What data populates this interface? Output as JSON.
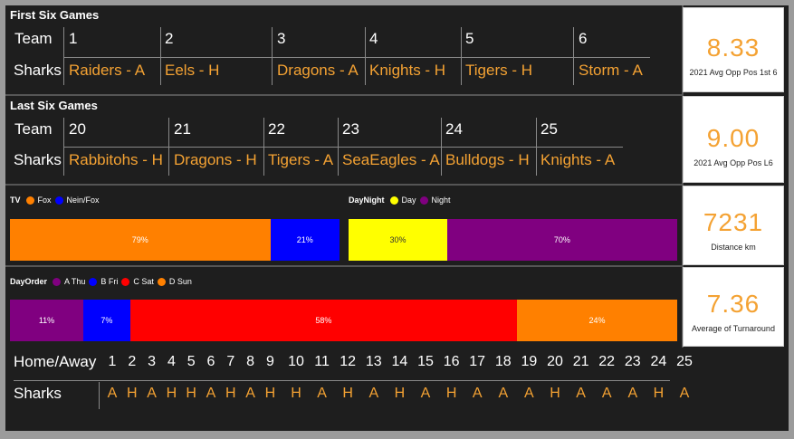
{
  "first_six": {
    "title": "First Six Games",
    "team_header": "Team",
    "team_name": "Sharks",
    "rounds": [
      "1",
      "2",
      "3",
      "4",
      "5",
      "6"
    ],
    "opponents": [
      "Raiders - A",
      "Eels - H",
      "Dragons - A",
      "Knights - H",
      "Tigers - H",
      "Storm - A"
    ]
  },
  "last_six": {
    "title": "Last Six Games",
    "team_header": "Team",
    "team_name": "Sharks",
    "rounds": [
      "20",
      "21",
      "22",
      "23",
      "24",
      "25"
    ],
    "opponents": [
      "Rabbitohs - H",
      "Dragons - H",
      "Tigers - A",
      "SeaEagles - A",
      "Bulldogs - H",
      "Knights - A"
    ]
  },
  "kpis": [
    {
      "value": "8.33",
      "label": "2021 Avg Opp Pos 1st 6"
    },
    {
      "value": "9.00",
      "label": "2021 Avg Opp Pos L6"
    },
    {
      "value": "7231",
      "label": "Distance km"
    },
    {
      "value": "7.36",
      "label": "Average of Turnaround"
    }
  ],
  "tv_chart": {
    "legend_title": "TV",
    "legend": [
      {
        "name": "Fox",
        "color": "#ff8000"
      },
      {
        "name": "Nein/Fox",
        "color": "#0000ff"
      }
    ],
    "segments": [
      {
        "label": "79%",
        "value": 79,
        "color": "#ff8000",
        "text_color": "#ffffff"
      },
      {
        "label": "21%",
        "value": 21,
        "color": "#0000ff",
        "text_color": "#ffffff"
      }
    ]
  },
  "daynight_chart": {
    "legend_title": "DayNight",
    "legend": [
      {
        "name": "Day",
        "color": "#ffff00"
      },
      {
        "name": "Night",
        "color": "#800080"
      }
    ],
    "segments": [
      {
        "label": "30%",
        "value": 30,
        "color": "#ffff00",
        "text_color": "#333333"
      },
      {
        "label": "70%",
        "value": 70,
        "color": "#800080",
        "text_color": "#ffffff"
      }
    ]
  },
  "dayorder_chart": {
    "legend_title": "DayOrder",
    "legend": [
      {
        "name": "A Thu",
        "color": "#800080"
      },
      {
        "name": "B Fri",
        "color": "#0000ff"
      },
      {
        "name": "C Sat",
        "color": "#ff0000"
      },
      {
        "name": "D Sun",
        "color": "#ff8000"
      }
    ],
    "segments": [
      {
        "label": "11%",
        "value": 11,
        "color": "#800080",
        "text_color": "#ffffff"
      },
      {
        "label": "7%",
        "value": 7,
        "color": "#0000ff",
        "text_color": "#ffffff"
      },
      {
        "label": "58%",
        "value": 58,
        "color": "#ff0000",
        "text_color": "#ffffff"
      },
      {
        "label": "24%",
        "value": 24,
        "color": "#ff8000",
        "text_color": "#ffffff"
      }
    ]
  },
  "home_away": {
    "header": "Home/Away",
    "team_name": "Sharks",
    "rounds": [
      "1",
      "2",
      "3",
      "4",
      "5",
      "6",
      "7",
      "8",
      "9",
      "10",
      "11",
      "12",
      "13",
      "14",
      "15",
      "16",
      "17",
      "18",
      "19",
      "20",
      "21",
      "22",
      "23",
      "24",
      "25"
    ],
    "values": [
      "A",
      "H",
      "A",
      "H",
      "H",
      "A",
      "H",
      "A",
      "H",
      "H",
      "A",
      "H",
      "A",
      "H",
      "A",
      "H",
      "A",
      "A",
      "A",
      "H",
      "A",
      "A",
      "A",
      "H",
      "A"
    ]
  }
}
